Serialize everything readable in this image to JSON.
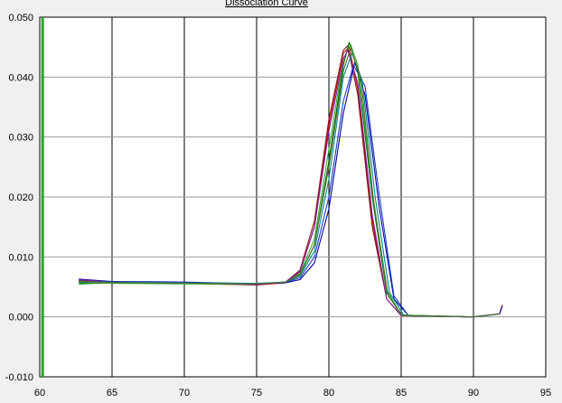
{
  "chart_data": {
    "type": "line",
    "title": "Dissociation Curve",
    "xlabel": "",
    "ylabel": "",
    "xlim": [
      60,
      95
    ],
    "ylim": [
      -0.01,
      0.05
    ],
    "x_ticks": [
      "60",
      "65",
      "70",
      "75",
      "80",
      "85",
      "90",
      "95"
    ],
    "y_ticks": [
      "-0.010",
      "0.000",
      "0.010",
      "0.020",
      "0.030",
      "0.040",
      "0.050"
    ],
    "grid": true,
    "legend": "none",
    "threshold_line": {
      "x": 60.2,
      "color": "#22aa22"
    },
    "series": [
      {
        "color": "#cc0000",
        "points": [
          [
            62.7,
            0.006
          ],
          [
            65,
            0.0058
          ],
          [
            70,
            0.0056
          ],
          [
            75,
            0.0053
          ],
          [
            77,
            0.0057
          ],
          [
            78,
            0.0075
          ],
          [
            79,
            0.015
          ],
          [
            80,
            0.032
          ],
          [
            81,
            0.044
          ],
          [
            81.4,
            0.045
          ],
          [
            82,
            0.038
          ],
          [
            83,
            0.016
          ],
          [
            84,
            0.003
          ],
          [
            85,
            0.0002
          ],
          [
            90,
            0.0
          ],
          [
            91.8,
            0.0005
          ],
          [
            92,
            0.002
          ]
        ]
      },
      {
        "color": "#8b1a1a",
        "points": [
          [
            62.7,
            0.0061
          ],
          [
            65,
            0.0057
          ],
          [
            70,
            0.0057
          ],
          [
            75,
            0.0054
          ],
          [
            77,
            0.0058
          ],
          [
            78,
            0.0078
          ],
          [
            79,
            0.016
          ],
          [
            80,
            0.033
          ],
          [
            81,
            0.0445
          ],
          [
            81.3,
            0.0452
          ],
          [
            82,
            0.037
          ],
          [
            83,
            0.015
          ],
          [
            84,
            0.003
          ],
          [
            85,
            0.0002
          ],
          [
            90,
            0.0
          ],
          [
            91.8,
            0.0005
          ]
        ]
      },
      {
        "color": "#0000aa",
        "points": [
          [
            62.7,
            0.0063
          ],
          [
            65,
            0.0059
          ],
          [
            70,
            0.0058
          ],
          [
            75,
            0.0055
          ],
          [
            77,
            0.0057
          ],
          [
            78,
            0.0062
          ],
          [
            79,
            0.009
          ],
          [
            80,
            0.018
          ],
          [
            81,
            0.034
          ],
          [
            81.8,
            0.0425
          ],
          [
            82.5,
            0.037
          ],
          [
            83.5,
            0.018
          ],
          [
            84.5,
            0.003
          ],
          [
            85.5,
            0.0002
          ],
          [
            90,
            0.0
          ],
          [
            91.8,
            0.0005
          ],
          [
            92,
            0.0018
          ]
        ]
      },
      {
        "color": "#1f3fbf",
        "points": [
          [
            62.7,
            0.0058
          ],
          [
            65,
            0.0058
          ],
          [
            70,
            0.0057
          ],
          [
            75,
            0.0055
          ],
          [
            77,
            0.0058
          ],
          [
            78,
            0.0065
          ],
          [
            79,
            0.01
          ],
          [
            80,
            0.02
          ],
          [
            81,
            0.036
          ],
          [
            81.7,
            0.042
          ],
          [
            82.5,
            0.0385
          ],
          [
            83.5,
            0.02
          ],
          [
            84.5,
            0.0035
          ],
          [
            85.5,
            0.0002
          ],
          [
            90,
            0.0
          ],
          [
            91.8,
            0.0005
          ]
        ]
      },
      {
        "color": "#006600",
        "points": [
          [
            62.7,
            0.0055
          ],
          [
            65,
            0.0057
          ],
          [
            70,
            0.0056
          ],
          [
            75,
            0.0054
          ],
          [
            77,
            0.0058
          ],
          [
            78,
            0.007
          ],
          [
            79,
            0.012
          ],
          [
            80,
            0.026
          ],
          [
            81,
            0.042
          ],
          [
            81.4,
            0.0458
          ],
          [
            82,
            0.041
          ],
          [
            83,
            0.02
          ],
          [
            84,
            0.004
          ],
          [
            85,
            0.0003
          ],
          [
            90,
            0.0
          ],
          [
            91.8,
            0.0005
          ]
        ]
      },
      {
        "color": "#33aa33",
        "points": [
          [
            62.7,
            0.0057
          ],
          [
            65,
            0.0056
          ],
          [
            70,
            0.0055
          ],
          [
            75,
            0.0054
          ],
          [
            77,
            0.0058
          ],
          [
            78,
            0.0072
          ],
          [
            79,
            0.013
          ],
          [
            80,
            0.028
          ],
          [
            81,
            0.043
          ],
          [
            81.5,
            0.0455
          ],
          [
            82,
            0.042
          ],
          [
            83,
            0.021
          ],
          [
            84,
            0.0045
          ],
          [
            85,
            0.0003
          ],
          [
            90,
            0.0
          ],
          [
            91.8,
            0.0005
          ]
        ]
      },
      {
        "color": "#7b1fa2",
        "points": [
          [
            62.7,
            0.0062
          ],
          [
            65,
            0.0058
          ],
          [
            70,
            0.0057
          ],
          [
            75,
            0.0054
          ],
          [
            77,
            0.0058
          ],
          [
            78,
            0.0076
          ],
          [
            79,
            0.015
          ],
          [
            80,
            0.031
          ],
          [
            81,
            0.043
          ],
          [
            81.3,
            0.0445
          ],
          [
            82,
            0.039
          ],
          [
            83,
            0.017
          ],
          [
            84,
            0.003
          ],
          [
            85,
            0.0002
          ],
          [
            90,
            0.0
          ],
          [
            91.8,
            0.0005
          ]
        ]
      },
      {
        "color": "#008b8b",
        "points": [
          [
            62.7,
            0.0059
          ],
          [
            65,
            0.0058
          ],
          [
            70,
            0.0057
          ],
          [
            75,
            0.0056
          ],
          [
            77,
            0.0058
          ],
          [
            78,
            0.0068
          ],
          [
            79,
            0.011
          ],
          [
            80,
            0.023
          ],
          [
            81,
            0.04
          ],
          [
            81.6,
            0.044
          ],
          [
            82.3,
            0.0395
          ],
          [
            83.2,
            0.02
          ],
          [
            84.2,
            0.004
          ],
          [
            85.2,
            0.0002
          ],
          [
            90,
            0.0
          ],
          [
            91.8,
            0.0005
          ]
        ]
      },
      {
        "color": "#556b2f",
        "points": [
          [
            62.7,
            0.006
          ],
          [
            65,
            0.0057
          ],
          [
            70,
            0.0056
          ],
          [
            75,
            0.0055
          ],
          [
            77,
            0.0058
          ],
          [
            78,
            0.007
          ],
          [
            79,
            0.012
          ],
          [
            80,
            0.025
          ],
          [
            81,
            0.041
          ],
          [
            81.5,
            0.0448
          ],
          [
            82.2,
            0.04
          ],
          [
            83.1,
            0.019
          ],
          [
            84.1,
            0.0035
          ],
          [
            85.1,
            0.0002
          ],
          [
            90,
            0.0
          ],
          [
            91.8,
            0.0005
          ]
        ]
      }
    ]
  }
}
